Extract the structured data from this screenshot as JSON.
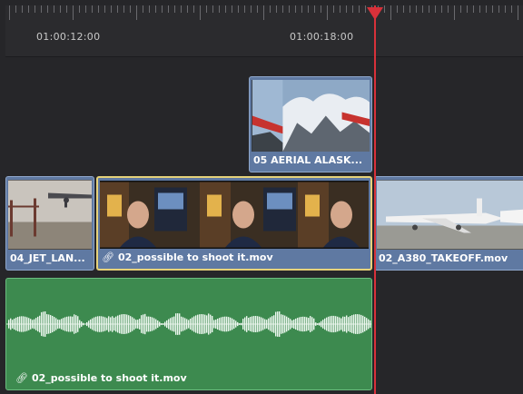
{
  "ruler": {
    "timecode_left": "01:00:12:00",
    "timecode_right": "01:00:18:00"
  },
  "tracks": {
    "video_upper": {
      "clip": {
        "label": "05 AERIAL  ALASK..."
      }
    },
    "video_main": {
      "clips": [
        {
          "label": "04_JET_LAN..."
        },
        {
          "label": "02_possible to shoot it.mov",
          "linked": true
        },
        {
          "label": "02_A380_TAKEOFF.mov"
        }
      ]
    },
    "audio": {
      "clip": {
        "label": "02_possible to shoot it.mov",
        "linked": true
      }
    }
  },
  "icons": {
    "link": "link-icon",
    "playhead": "playhead-marker-icon"
  },
  "colors": {
    "video_clip": "#5f79a2",
    "audio_clip": "#3d8a4f",
    "playhead": "#d8313a"
  }
}
